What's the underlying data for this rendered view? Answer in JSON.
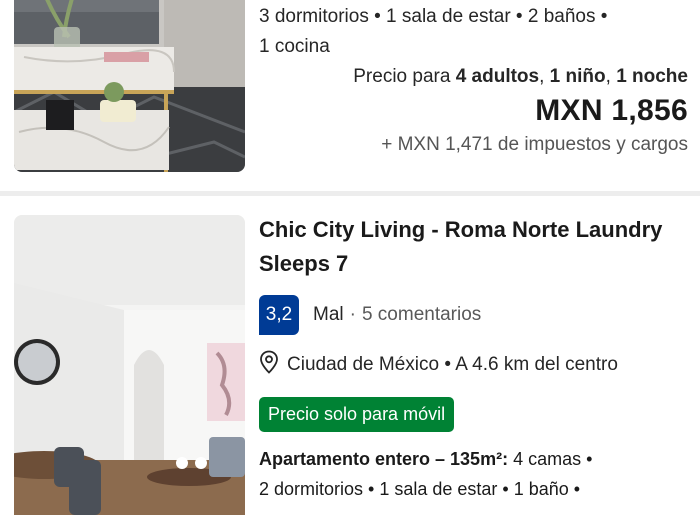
{
  "listing1": {
    "amenities_line1": "3 dormitorios • 1 sala de estar • 2 baños •",
    "amenities_line2": "1 cocina",
    "price_for_prefix": "Precio para ",
    "price_for_adults": "4 adultos",
    "price_for_sep1": ", ",
    "price_for_child": "1 niño",
    "price_for_sep2": ", ",
    "price_for_night": "1 noche",
    "price": "MXN 1,856",
    "taxes": "+ MXN 1,471 de impuestos y cargos"
  },
  "listing2": {
    "title_line1": "Chic City Living - Roma Norte Laundry",
    "title_line2": "Sleeps 7",
    "score": "3,2",
    "rating_label": "Mal",
    "rating_separator": "·",
    "reviews": "5 comentarios",
    "location": "Ciudad de México • A 4.6 km del centro",
    "mobile_badge": "Precio solo para móvil",
    "unit_type": "Apartamento entero – 135m²:",
    "unit_beds": " 4 camas •",
    "amenities_line": "2 dormitorios • 1 sala de estar • 1 baño •"
  },
  "icons": {
    "location": "map-pin-icon"
  },
  "colors": {
    "score_bg": "#003b95",
    "badge_bg": "#008234",
    "divider": "#ededed"
  }
}
